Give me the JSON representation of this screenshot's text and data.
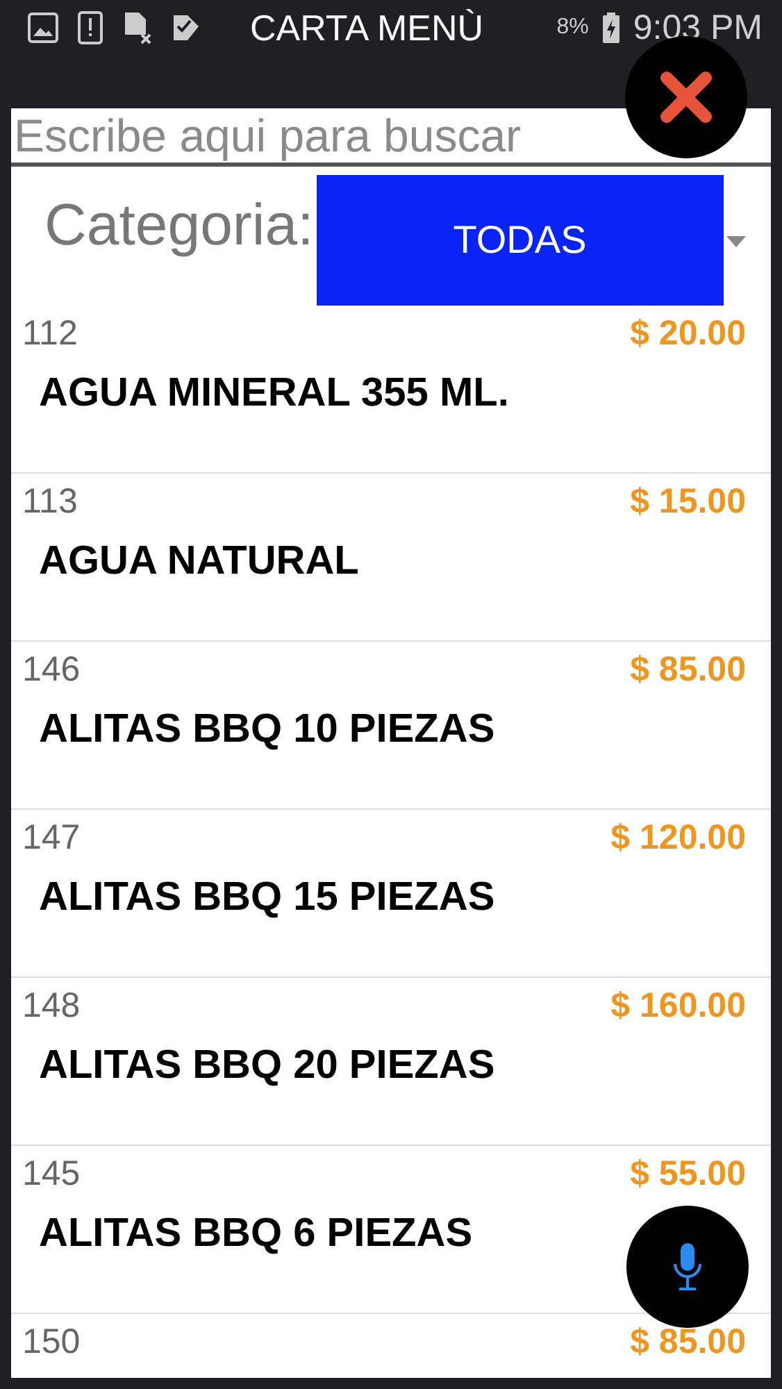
{
  "status_bar": {
    "title": "CARTA MENÙ",
    "battery": "8%",
    "time": "9:03 PM"
  },
  "search": {
    "placeholder": "Escribe aqui para buscar"
  },
  "category": {
    "label": "Categoria:",
    "value": "TODAS"
  },
  "items": [
    {
      "code": "112",
      "name": "AGUA MINERAL 355 ML.",
      "price": "$ 20.00"
    },
    {
      "code": "113",
      "name": "AGUA NATURAL",
      "price": "$ 15.00"
    },
    {
      "code": "146",
      "name": "ALITAS BBQ 10 PIEZAS",
      "price": "$ 85.00"
    },
    {
      "code": "147",
      "name": "ALITAS BBQ 15 PIEZAS",
      "price": "$ 120.00"
    },
    {
      "code": "148",
      "name": "ALITAS BBQ 20 PIEZAS",
      "price": "$ 160.00"
    },
    {
      "code": "145",
      "name": "ALITAS BBQ 6 PIEZAS",
      "price": "$ 55.00"
    },
    {
      "code": "150",
      "price": "$ 85.00"
    }
  ]
}
